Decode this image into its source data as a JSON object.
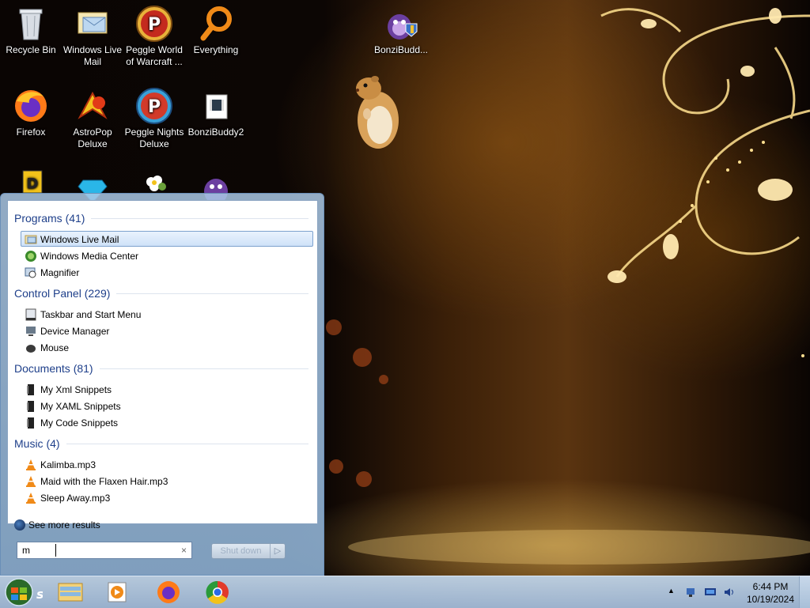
{
  "desktop": {
    "icons": [
      {
        "label": "Recycle Bin"
      },
      {
        "label": "Windows Live Mail"
      },
      {
        "label": "Peggle World of Warcraft ..."
      },
      {
        "label": "Everything"
      },
      {
        "label": "BonziBudd..."
      },
      {
        "label": "Firefox"
      },
      {
        "label": "AstroPop Deluxe"
      },
      {
        "label": "Peggle Nights Deluxe"
      },
      {
        "label": "BonziBuddy2"
      }
    ]
  },
  "start_menu": {
    "groups": [
      {
        "title": "Programs (41)",
        "items": [
          {
            "label": "Windows Live Mail",
            "icon": "mail-icon"
          },
          {
            "label": "Windows Media Center",
            "icon": "media-center-icon"
          },
          {
            "label": "Magnifier",
            "icon": "magnifier-icon"
          }
        ]
      },
      {
        "title": "Control Panel (229)",
        "items": [
          {
            "label": "Taskbar and Start Menu",
            "icon": "taskbar-icon"
          },
          {
            "label": "Device Manager",
            "icon": "device-manager-icon"
          },
          {
            "label": "Mouse",
            "icon": "mouse-icon"
          }
        ]
      },
      {
        "title": "Documents (81)",
        "items": [
          {
            "label": "My Xml Snippets",
            "icon": "document-icon"
          },
          {
            "label": "My XAML Snippets",
            "icon": "document-icon"
          },
          {
            "label": "My Code Snippets",
            "icon": "document-icon"
          }
        ]
      },
      {
        "title": "Music (4)",
        "items": [
          {
            "label": "Kalimba.mp3",
            "icon": "vlc-icon"
          },
          {
            "label": "Maid with the Flaxen Hair.mp3",
            "icon": "vlc-icon"
          },
          {
            "label": "Sleep Away.mp3",
            "icon": "vlc-icon"
          }
        ]
      }
    ],
    "see_more": "See more results",
    "search": {
      "value": "m",
      "clear": "×"
    },
    "shutdown": {
      "label": "Shut down",
      "arrow": "▷"
    }
  },
  "taskbar": {
    "start_label": "start",
    "tray_arrow": "▲",
    "clock": {
      "time": "6:44 PM",
      "date": "10/19/2024"
    }
  },
  "colors": {
    "group_header": "#1e3f8a",
    "selection_border": "#7da2ce"
  }
}
